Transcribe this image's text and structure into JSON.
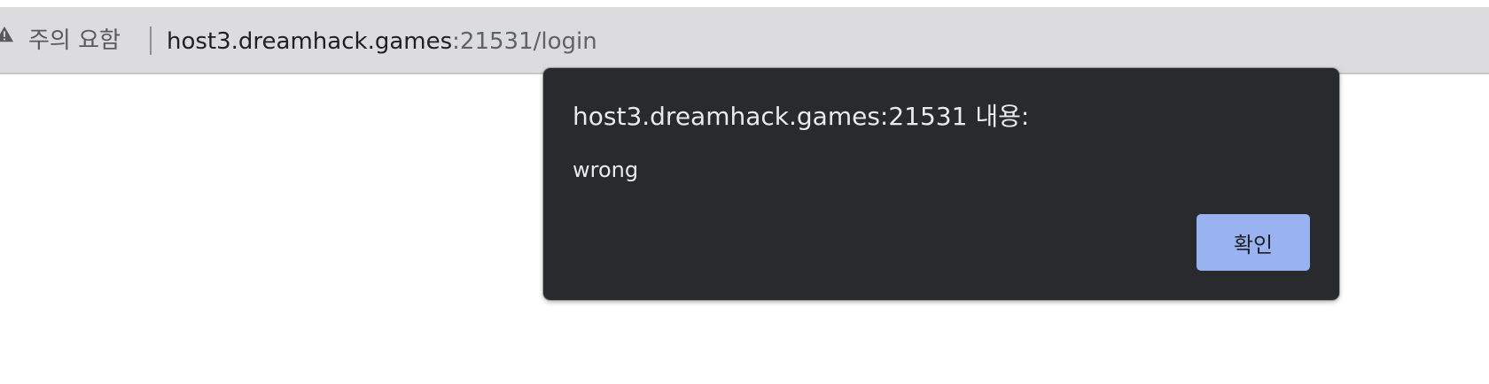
{
  "address_bar": {
    "security_label": "주의 요함",
    "security_icon": "warning-triangle-icon",
    "url_host": "host3.dreamhack.games",
    "url_rest": ":21531/login"
  },
  "alert_dialog": {
    "title": "host3.dreamhack.games:21531 내용:",
    "message": "wrong",
    "ok_label": "확인"
  },
  "colors": {
    "toolbar_bg": "#dcdcde",
    "dialog_bg": "#292a2e",
    "button_bg": "#99b3f2"
  }
}
